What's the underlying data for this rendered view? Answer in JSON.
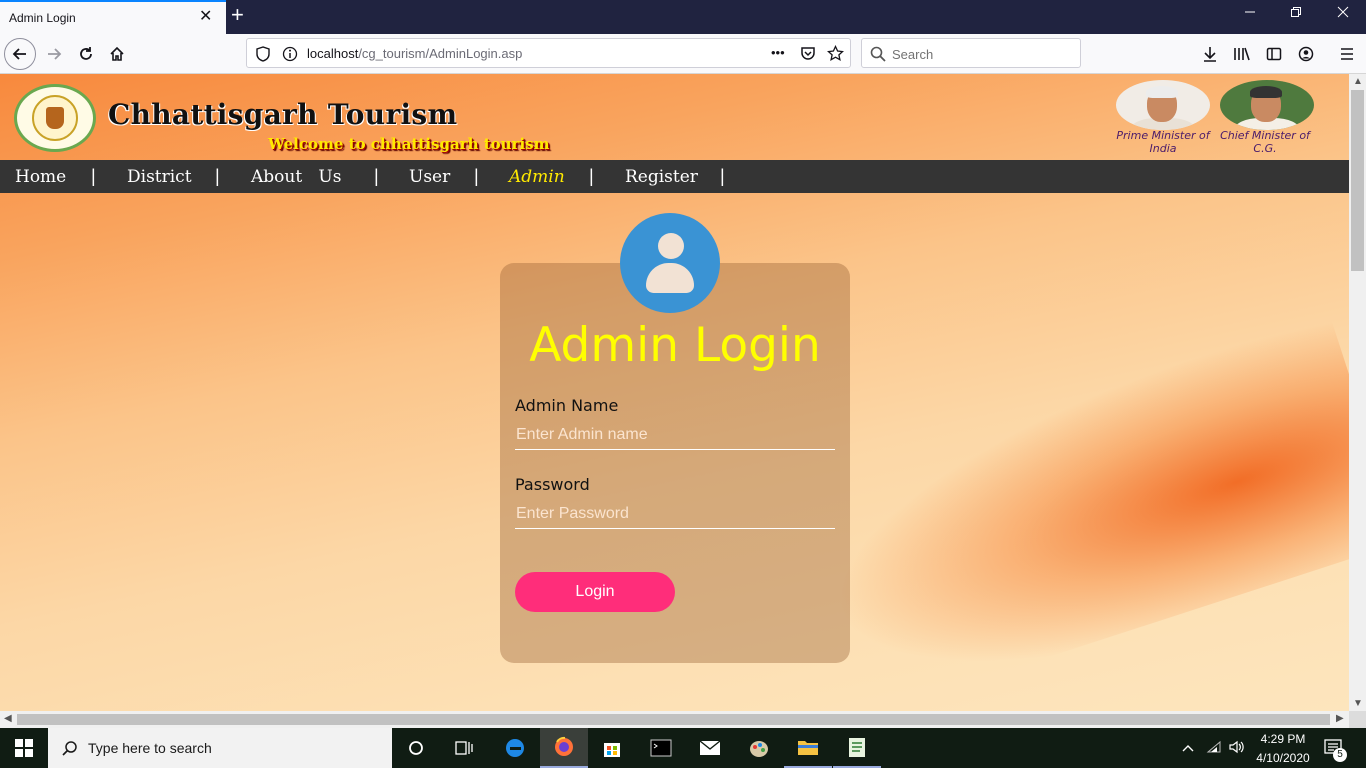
{
  "browser": {
    "tab_title": "Admin Login",
    "tab_close": "✕",
    "new_tab": "+",
    "url_host": "localhost",
    "url_path": "/cg_tourism/AdminLogin.asp",
    "search_placeholder": "Search",
    "url_more": "•••"
  },
  "site": {
    "title": "Chhattisgarh Tourism",
    "welcome": "Welcome to chhattisgarh tourism",
    "pm_caption": "Prime Minister of India",
    "cm_caption": "Chief Minister of C.G."
  },
  "nav": {
    "items": [
      {
        "label": "Home"
      },
      {
        "label": "District"
      },
      {
        "label": "About   Us"
      },
      {
        "label": "User"
      },
      {
        "label": "Admin",
        "active": true
      },
      {
        "label": "Register"
      }
    ],
    "separator": "|"
  },
  "login": {
    "title": "Admin Login",
    "name_label": "Admin Name",
    "name_placeholder": "Enter Admin name",
    "name_value": "",
    "password_label": "Password",
    "password_placeholder": "Enter Password",
    "password_value": "",
    "button_label": "Login"
  },
  "taskbar": {
    "search_text": "Type here to search",
    "time": "4:29 PM",
    "date": "4/10/2020",
    "notification_count": "5"
  },
  "colors": {
    "accent_yellow": "#ffff00",
    "login_button": "#ff2d7a",
    "avatar": "#3a93d4",
    "nav_bg": "#343434"
  }
}
